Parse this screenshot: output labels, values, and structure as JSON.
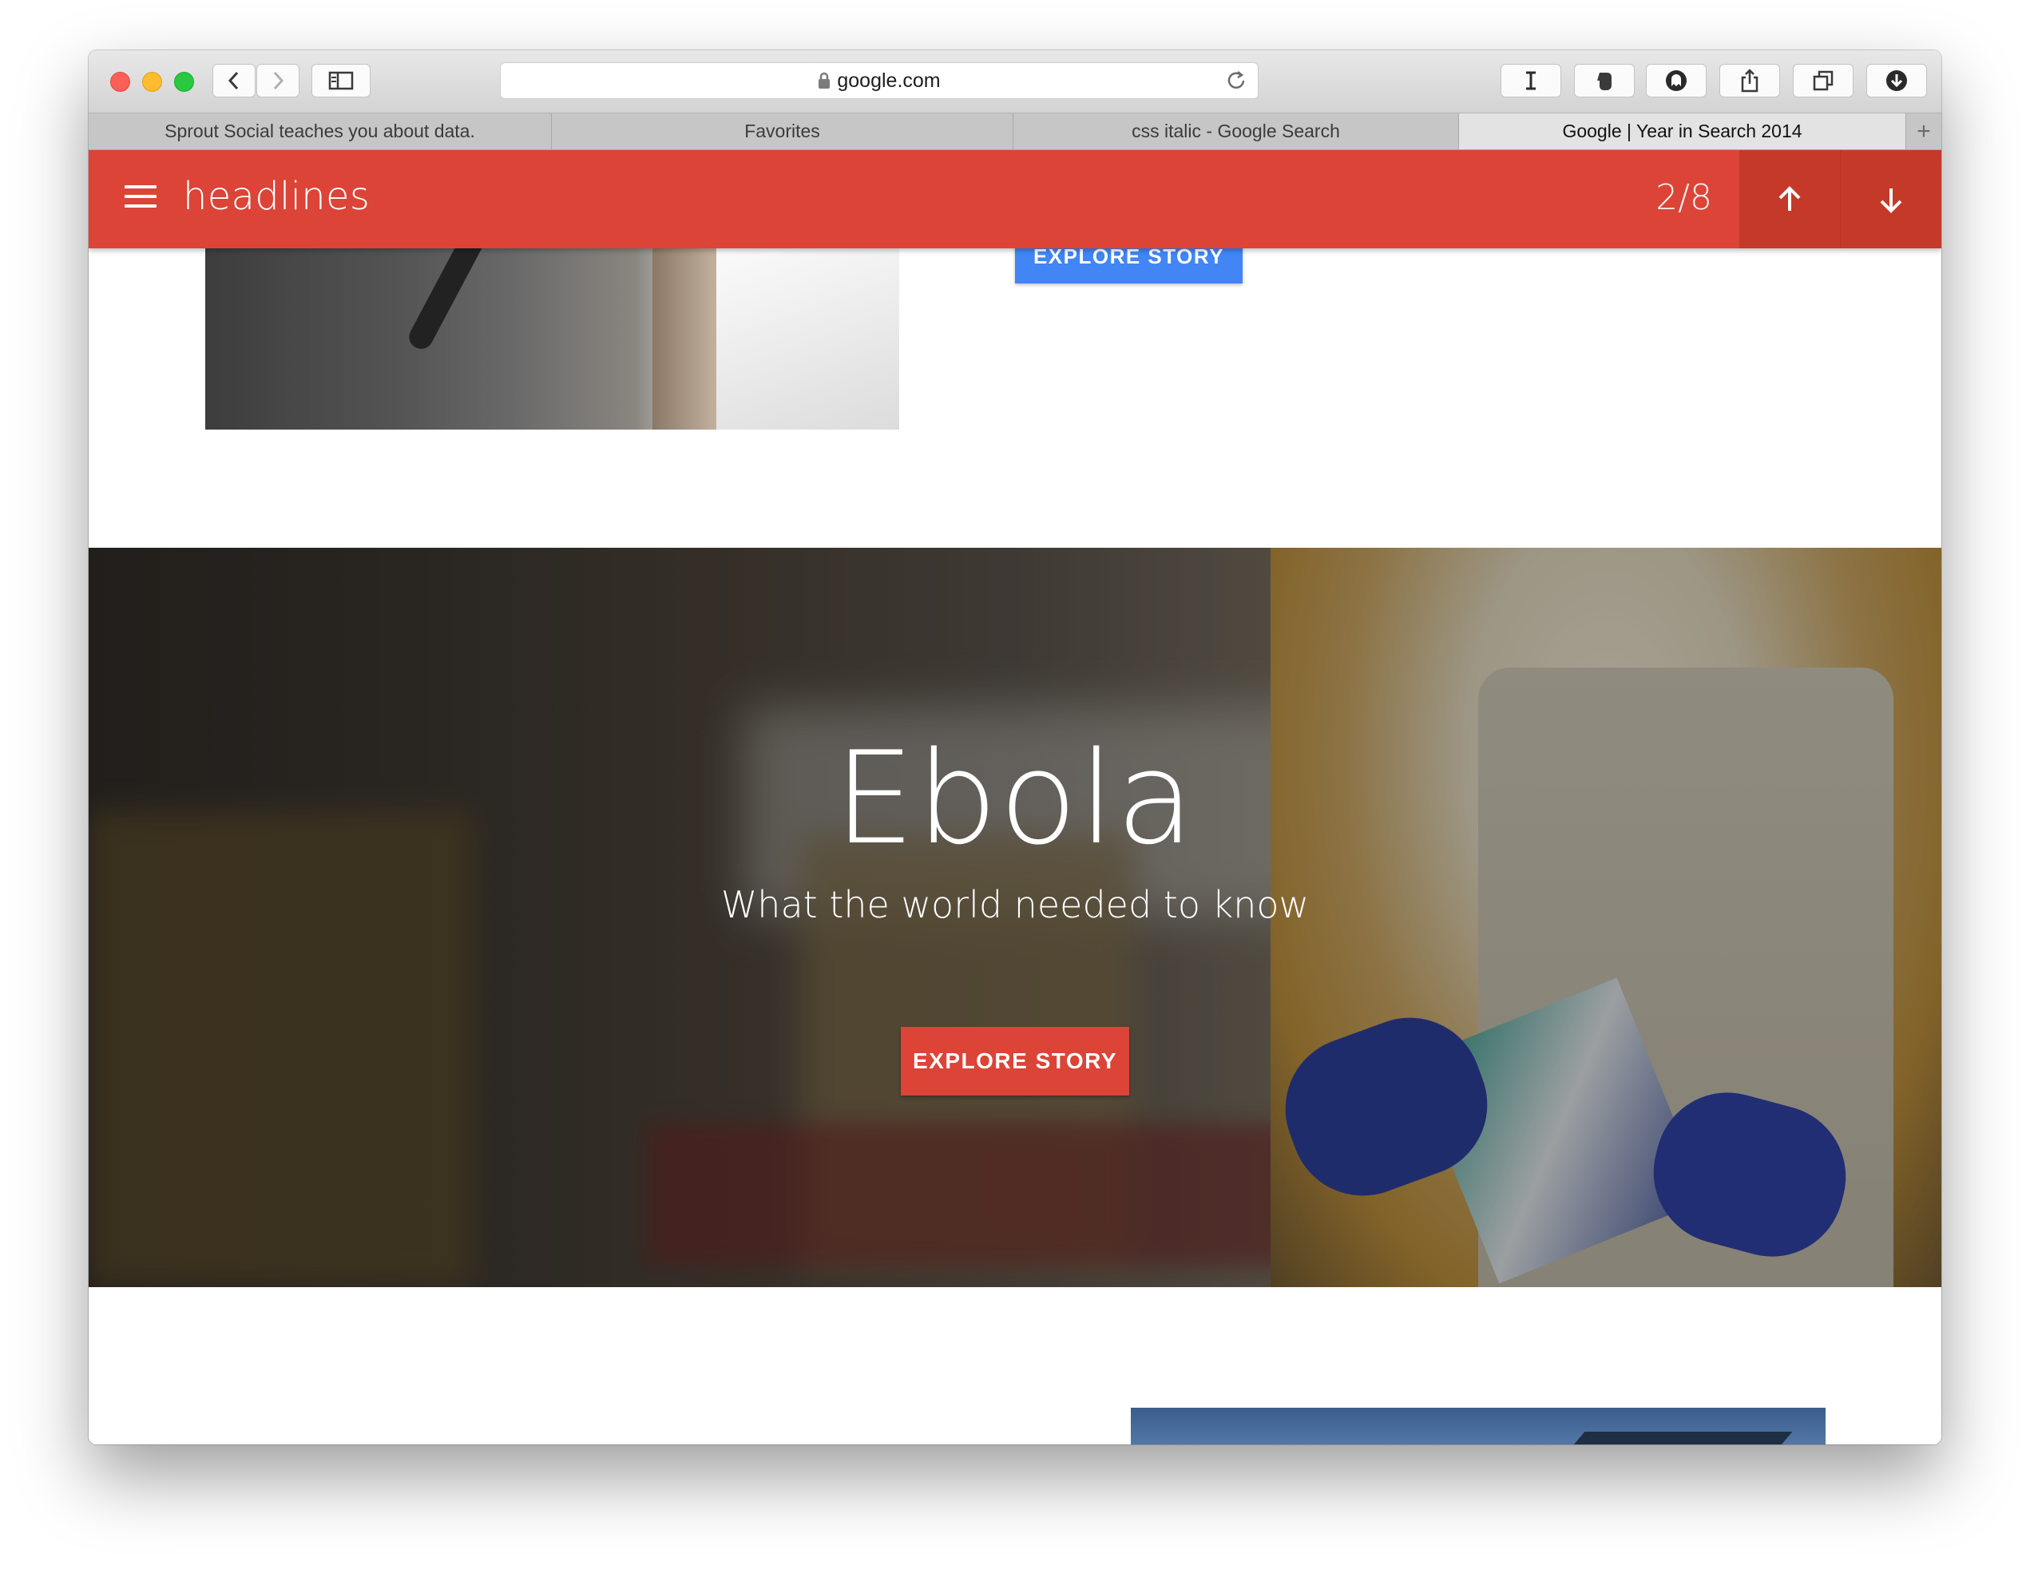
{
  "browser": {
    "address": {
      "url": "google.com"
    },
    "toolbar_icons": [
      "back-icon",
      "forward-icon",
      "sidebar-icon",
      "lock-icon",
      "reload-icon",
      "instapaper-icon",
      "evernote-icon",
      "ghostery-icon",
      "share-icon",
      "tabs-overview-icon",
      "downloads-icon"
    ],
    "tabs": [
      {
        "title": "Sprout Social teaches you about data.",
        "active": false
      },
      {
        "title": "Favorites",
        "active": false
      },
      {
        "title": "css italic - Google Search",
        "active": false
      },
      {
        "title": "Google | Year in Search 2014",
        "active": true
      }
    ],
    "new_tab_label": "+"
  },
  "appbar": {
    "title": "headlines",
    "counter": "2/8",
    "color": "#db4437",
    "nav_color": "#c53929"
  },
  "previous_story": {
    "button_label": "EXPLORE STORY",
    "button_color": "#4285f4"
  },
  "featured_story": {
    "title": "Ebola",
    "subtitle": "What the world needed to know",
    "button_label": "EXPLORE STORY",
    "button_color": "#db4437"
  }
}
